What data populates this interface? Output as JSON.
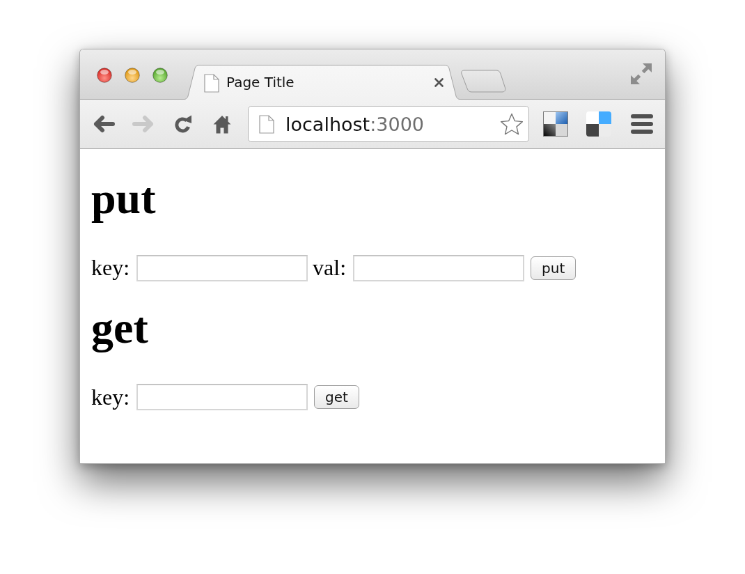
{
  "window": {
    "tabs": [
      {
        "title": "Page Title",
        "selected": true
      }
    ],
    "toolbar": {
      "nav_buttons": [
        {
          "kind": "back",
          "disabled": false
        },
        {
          "kind": "forward",
          "disabled": true
        },
        {
          "kind": "reload",
          "disabled": false
        },
        {
          "kind": "home",
          "disabled": false
        }
      ],
      "address": {
        "host": "localhost",
        "port": ":3000",
        "bookmarked": false
      }
    },
    "page": {
      "sections": [
        {
          "heading": "put",
          "fields": [
            {
              "label": "key:"
            },
            {
              "label": "val:"
            }
          ],
          "button": "put"
        },
        {
          "heading": "get",
          "fields": [
            {
              "label": "key:"
            }
          ],
          "button": "get"
        }
      ]
    }
  }
}
